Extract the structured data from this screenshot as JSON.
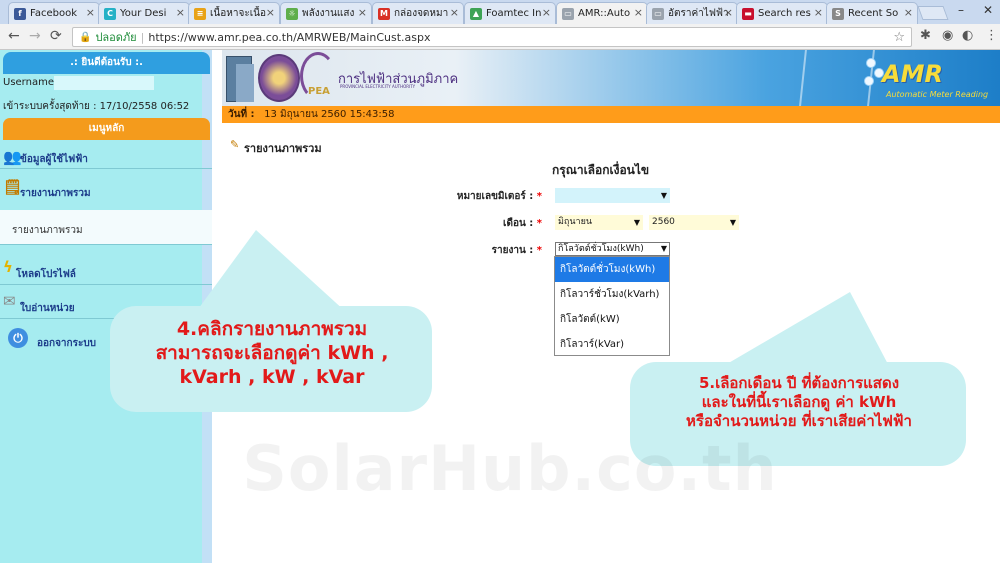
{
  "browser": {
    "tabs": [
      {
        "label": "Facebook",
        "icon": "facebook-icon",
        "color": "#3b5998",
        "glyph": "f"
      },
      {
        "label": "Your Desi",
        "icon": "canva-icon",
        "color": "#25b1c6",
        "glyph": "C"
      },
      {
        "label": "เนื้อหาจะเนื้อ",
        "icon": "site-icon",
        "color": "#e8a217",
        "glyph": "≡"
      },
      {
        "label": "พลังงานแสง",
        "icon": "site-icon",
        "color": "#5fae4b",
        "glyph": "☼"
      },
      {
        "label": "กล่องจดหมา",
        "icon": "gmail-icon",
        "color": "#d93025",
        "glyph": "M"
      },
      {
        "label": "Foamtec In",
        "icon": "site-icon",
        "color": "#3ea355",
        "glyph": "▲"
      },
      {
        "label": "AMR::Auto",
        "icon": "page-icon",
        "color": "#9aa3ad",
        "glyph": "▭",
        "active": true
      },
      {
        "label": "อัตราค่าไฟฟ้า",
        "icon": "page-icon",
        "color": "#9aa3ad",
        "glyph": "▭"
      },
      {
        "label": "Search res",
        "icon": "thai-flag-icon",
        "color": "#c8102e",
        "glyph": "▬"
      },
      {
        "label": "Recent So",
        "icon": "site-icon",
        "color": "#888",
        "glyph": "S"
      }
    ],
    "address": {
      "secure_label": "ปลอดภัย",
      "url": "https://www.amr.pea.co.th/AMRWEB/MainCust.aspx"
    }
  },
  "sidebar": {
    "welcome": ".: ยินดีต้อนรับ :.",
    "username_label": "Username :",
    "last_login_label": "เข้าระบบครั้งสุดท้าย :",
    "last_login_value": "17/10/2558 06:52",
    "menu_header": "เมนูหลัก",
    "items": [
      {
        "label": "ข้อมูลผู้ใช้ไฟฟ้า",
        "icon": "users-icon"
      },
      {
        "label": "รายงานภาพรวม",
        "icon": "report-icon"
      },
      {
        "label": "โหลดโปรไฟล์",
        "icon": "lightning-icon"
      },
      {
        "label": "ใบอ่านหน่วย",
        "icon": "document-icon"
      },
      {
        "label": "ออกจากระบบ",
        "icon": "power-icon"
      }
    ],
    "sub_item": "รายงานภาพรวม"
  },
  "header": {
    "org_name": "การไฟฟ้าส่วนภูมิภาค",
    "org_sub": "PROVINCIAL ELECTRICITY AUTHORITY",
    "pea_text": "PEA",
    "amr_logo": "AMR",
    "amr_sub": "Automatic Meter Reading",
    "date_label": "วันที่ :",
    "date_value": "13 มิถุนายน 2560  15:43:58"
  },
  "main": {
    "report_title": "รายงานภาพรวม",
    "condition_title": "กรุณาเลือกเงื่อนไข",
    "meter_label": "หมายเลขมิเตอร์ :",
    "month_label": "เดือน :",
    "month_value": "มิถุนายน",
    "year_value": "2560",
    "report_label": "รายงาน :",
    "report_value": "กิโลวัตต์ชั่วโมง(kWh)",
    "report_options": [
      "กิโลวัตต์ชั่วโมง(kWh)",
      "กิโลวาร์ชั่วโมง(kVarh)",
      "กิโลวัตต์(kW)",
      "กิโลวาร์(kVar)"
    ],
    "required_mark": "*"
  },
  "annotations": {
    "left_lines": [
      "4.คลิกรายงานภาพรวม",
      "สามารถจะเลือกดูค่า kWh ,",
      "kVarh , kW , kVar"
    ],
    "right_lines": [
      "5.เลือกเดือน ปี ที่ต้องการแสดง",
      "และในที่นี้เราเลือกดู ค่า kWh",
      "หรือจำนวนหน่วย ที่เราเสียค่าไฟฟ้า"
    ],
    "watermark": "SolarHub.co.th"
  }
}
